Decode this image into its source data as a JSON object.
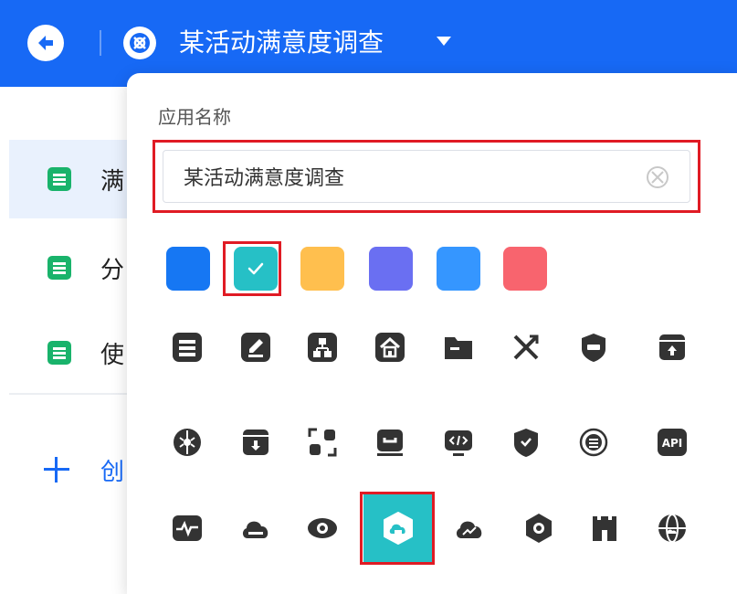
{
  "header": {
    "title": "某活动满意度调查",
    "background": "#1769f5"
  },
  "sidebar": {
    "items": [
      {
        "label": "满",
        "active": true,
        "icon": "document-list-icon"
      },
      {
        "label": "分",
        "active": false,
        "icon": "document-list-icon"
      },
      {
        "label": "使",
        "active": false,
        "icon": "document-list-icon"
      }
    ],
    "create_label": "创"
  },
  "popover": {
    "field_label": "应用名称",
    "name_value": "某活动满意度调查",
    "colors": [
      {
        "name": "blue",
        "hex": "#1677f3"
      },
      {
        "name": "teal",
        "hex": "#26c0c6",
        "selected": true
      },
      {
        "name": "orange",
        "hex": "#ffbf4e"
      },
      {
        "name": "indigo",
        "hex": "#6a6ff2"
      },
      {
        "name": "sky",
        "hex": "#3596ff"
      },
      {
        "name": "red",
        "hex": "#f8646e"
      }
    ],
    "icons_row1": [
      "document-list-icon",
      "edit-icon",
      "org-chart-icon",
      "home-icon",
      "folder-icon",
      "utensils-icon",
      "shield-card-icon",
      "upload-box-icon"
    ],
    "icons_row2": [
      "brain-icon",
      "download-box-icon",
      "scan-icon",
      "inbox-icon",
      "code-screen-icon",
      "shield-icon",
      "database-globe-icon",
      "api-icon"
    ],
    "icons_row3": [
      "pulse-monitor-icon",
      "cloud-icon",
      "eye-icon",
      "hexagon-cloud-icon",
      "cloud-trend-icon",
      "hexagon-eye-icon",
      "castle-icon",
      "globe-icon"
    ],
    "icon_text": {
      "api": "API"
    },
    "selected_icon": "hexagon-cloud-icon"
  }
}
